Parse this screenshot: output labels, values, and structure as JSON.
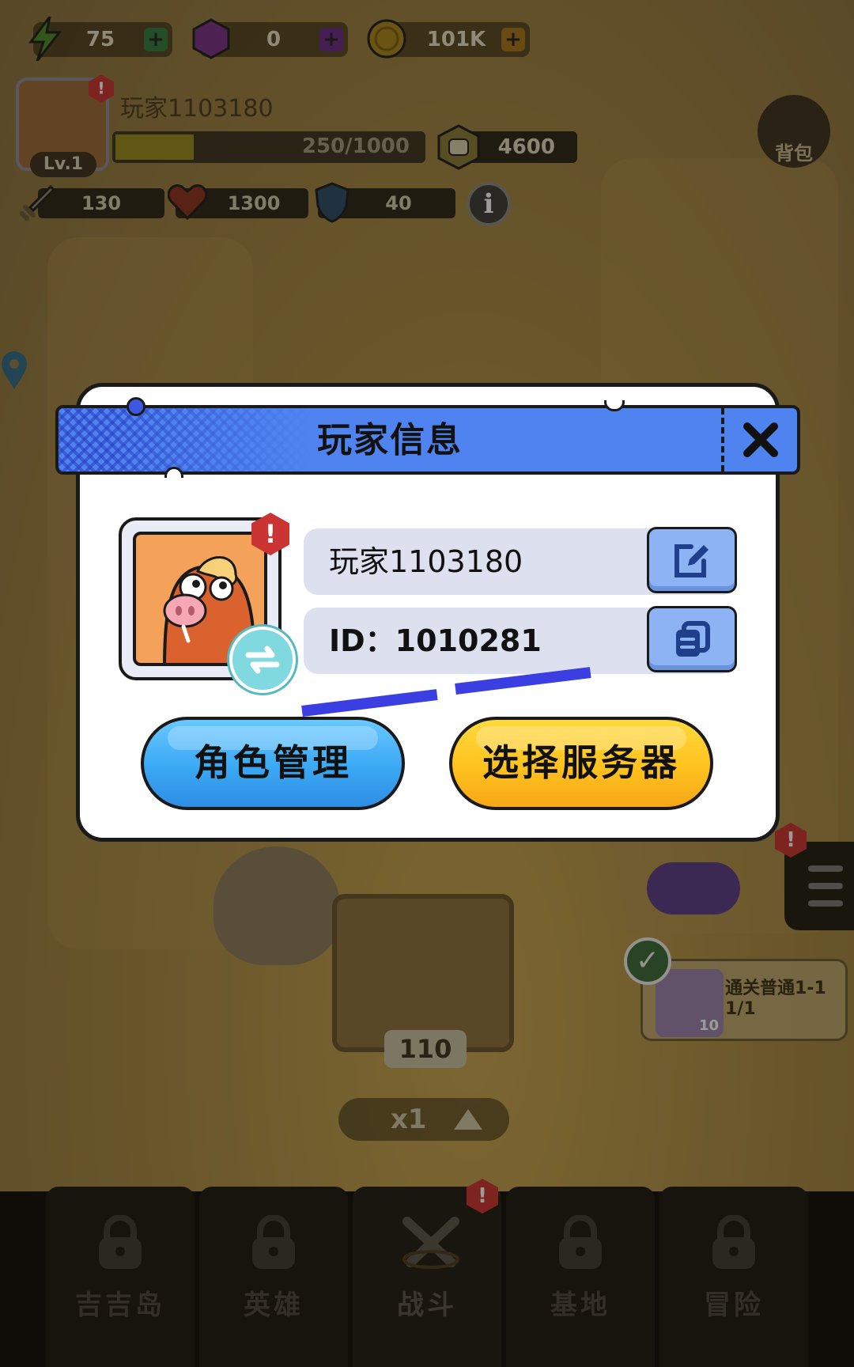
{
  "resources": {
    "energy": {
      "value": "75",
      "icon": "lightning-icon"
    },
    "gems": {
      "value": "0",
      "icon": "gem-icon"
    },
    "coins": {
      "value": "101K",
      "icon": "coin-icon"
    }
  },
  "player_header": {
    "name": "玩家1103180",
    "level": "Lv.1",
    "xp_text": "250/1000",
    "xp_fraction": 0.25,
    "power": "4600",
    "stats": {
      "attack": "130",
      "hp": "1300",
      "defense": "40"
    },
    "bag_label": "背包"
  },
  "dialog": {
    "title": "玩家信息",
    "player_name": "玩家1103180",
    "player_id": "ID：1010281",
    "role_button": "角色管理",
    "server_button": "选择服务器"
  },
  "battle": {
    "crate_count": "110",
    "speed": "x1"
  },
  "quest": {
    "title": "通关普通1-1",
    "progress": "1/1",
    "reward_count": "10"
  },
  "nav": {
    "items": [
      {
        "label": "吉吉岛",
        "locked": true
      },
      {
        "label": "英雄",
        "locked": true
      },
      {
        "label": "战斗",
        "locked": false
      },
      {
        "label": "基地",
        "locked": true
      },
      {
        "label": "冒险",
        "locked": true
      }
    ]
  },
  "colors": {
    "title_bar": "#4f84f0",
    "blue_button": "#3aa8f3",
    "yellow_button": "#ffc21e",
    "field_bg": "#dde0ee",
    "underline": "#3b3ee0"
  }
}
